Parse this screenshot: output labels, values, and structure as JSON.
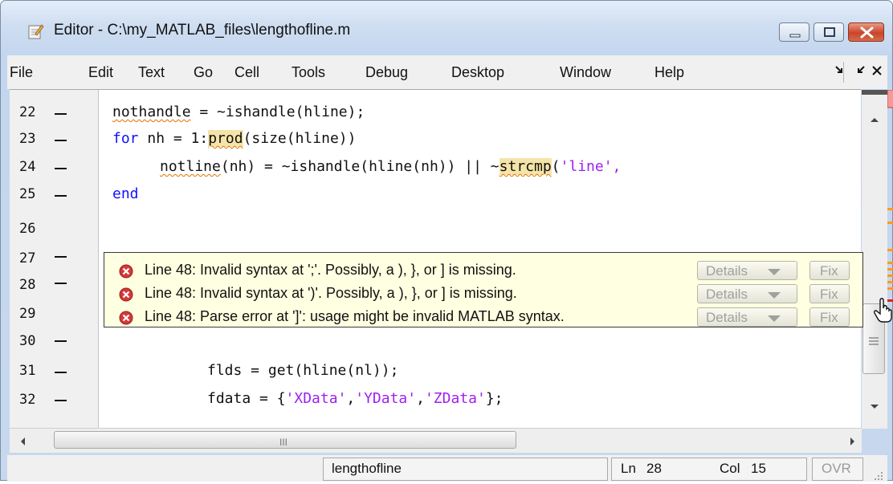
{
  "window": {
    "title": "Editor - C:\\my_MATLAB_files\\lengthofline.m",
    "controls": [
      "minimize-icon",
      "maximize-icon",
      "close-icon"
    ],
    "close_color": "#c8452a"
  },
  "menubar": {
    "items": [
      {
        "label": "File"
      },
      {
        "label": "Edit"
      },
      {
        "label": "Text"
      },
      {
        "label": "Go"
      },
      {
        "label": "Cell"
      },
      {
        "label": "Tools"
      },
      {
        "label": "Debug"
      },
      {
        "label": "Desktop"
      },
      {
        "label": "Window"
      },
      {
        "label": "Help"
      }
    ],
    "icons": [
      "undock-icon",
      "restore-icon",
      "close-doc-icon"
    ]
  },
  "editor": {
    "lines": [
      {
        "num": "22",
        "dash": true
      },
      {
        "num": "23",
        "dash": true
      },
      {
        "num": "24",
        "dash": true
      },
      {
        "num": "25",
        "dash": true
      },
      {
        "num": "26",
        "dash": false
      },
      {
        "num": "27",
        "dash": true
      },
      {
        "num": "28",
        "dash": true
      },
      {
        "num": "29",
        "dash": false
      },
      {
        "num": "30",
        "dash": true
      },
      {
        "num": "31",
        "dash": true
      },
      {
        "num": "32",
        "dash": true
      }
    ],
    "code": {
      "l22": {
        "a": "nothandle",
        "b": " = ~ishandle(hline);"
      },
      "l23": {
        "a": "for",
        "b": " nh = 1:",
        "c": "prod",
        "d": "(size(hline))"
      },
      "l24": {
        "a": "notline",
        "b": "(nh) = ~ishandle(hline(nh)) || ~",
        "c": "strcmp",
        "d": "(",
        "e": "'line',"
      },
      "l25": {
        "a": "end"
      },
      "l31": {
        "a": "flds = get(hline(nl));"
      },
      "l32": {
        "a": "fdata = {",
        "b": "'XData'",
        "c": ",",
        "d": "'YData'",
        "e": ",",
        "f": "'ZData'",
        "g": "};"
      }
    },
    "colors": {
      "keyword": "#1010ff",
      "string": "#a020f0",
      "highlight": "#f5e4a8",
      "warning_underline": "#e07000"
    }
  },
  "messages": {
    "items": [
      {
        "text": "Line 48: Invalid syntax at ';'. Possibly, a ), }, or ] is missing.",
        "details": "Details",
        "fix": "Fix"
      },
      {
        "text": "Line 48: Invalid syntax at ')'. Possibly, a ), }, or ] is missing.",
        "details": "Details",
        "fix": "Fix"
      },
      {
        "text": "Line 48: Parse error at ']': usage might be invalid MATLAB syntax.",
        "details": "Details",
        "fix": "Fix"
      }
    ],
    "icon": "error-icon",
    "error_color": "#d33a3a",
    "background": "#ffffe1"
  },
  "scrollbars": {
    "horizontal_grip": "III",
    "marker_colors": {
      "warning": "#ff9a1a",
      "error": "#e02020",
      "status": "#f29b9b"
    }
  },
  "statusbar": {
    "function_name": "lengthofline",
    "ln_label": "Ln",
    "ln_value": "28",
    "col_label": "Col",
    "col_value": "15",
    "mode": "OVR"
  }
}
